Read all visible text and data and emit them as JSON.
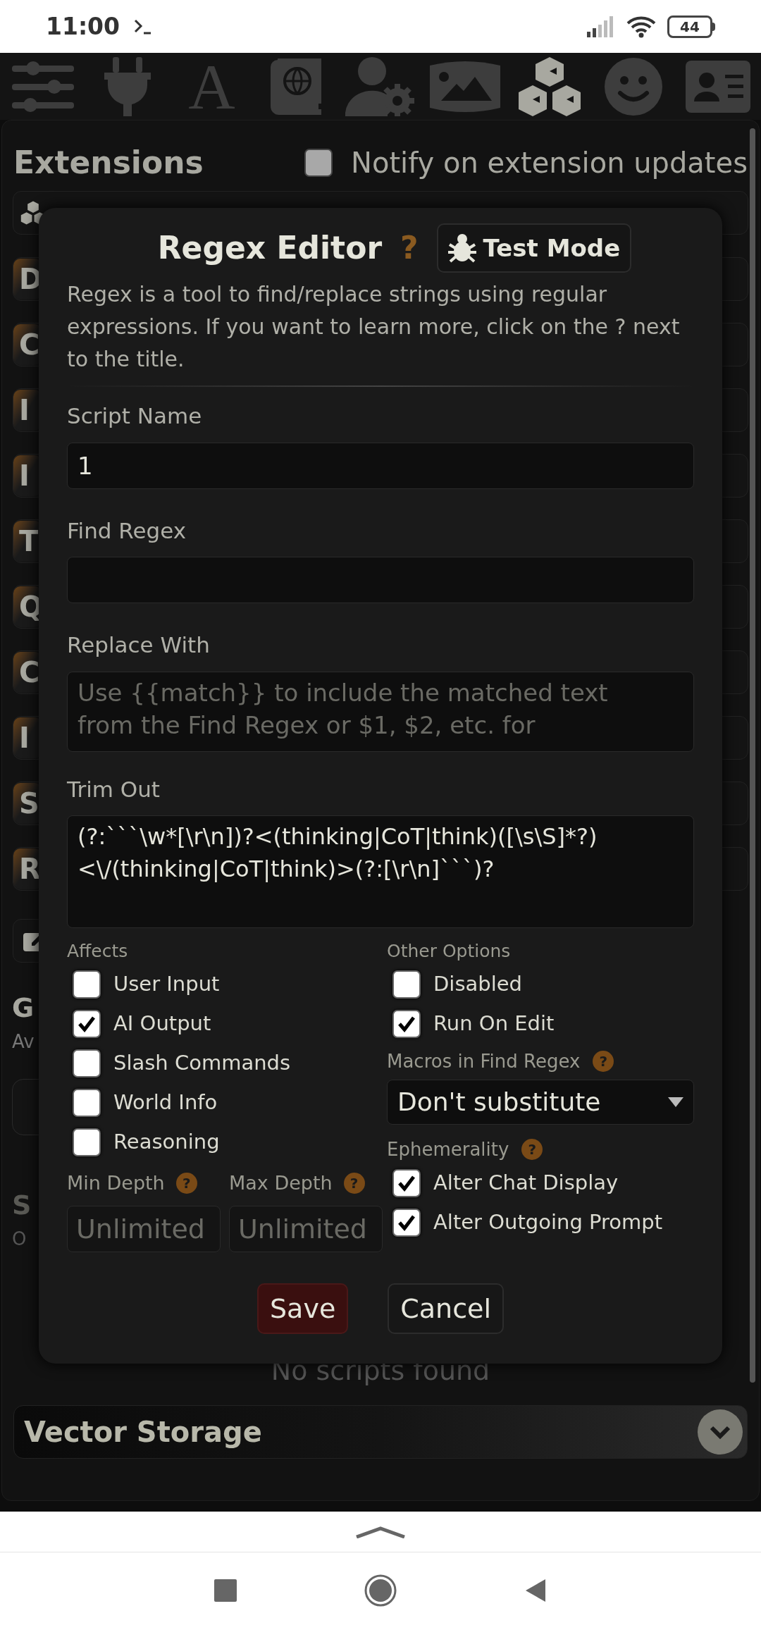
{
  "status_bar": {
    "time": "11:00",
    "battery": "44"
  },
  "toolbar": [
    {
      "kind": "sliders",
      "selected": false
    },
    {
      "kind": "plug",
      "selected": false
    },
    {
      "kind": "letter",
      "text": "A",
      "selected": false
    },
    {
      "kind": "book",
      "selected": false
    },
    {
      "kind": "user-gear",
      "selected": false
    },
    {
      "kind": "image",
      "selected": false
    },
    {
      "kind": "cubes",
      "selected": true
    },
    {
      "kind": "smiley",
      "selected": false
    },
    {
      "kind": "id-card",
      "selected": false
    }
  ],
  "extensions": {
    "title": "Extensions",
    "notify": {
      "label": "Notify on extension updates",
      "checked": false
    }
  },
  "extension_rows": [
    "D",
    "C",
    "I",
    "I",
    "T",
    "Q",
    "C",
    "I",
    "S",
    "R"
  ],
  "gallery": {
    "title": "G",
    "subtitle": "Av"
  },
  "scripts": {
    "title": "S",
    "subtitle": "O",
    "empty": "No scripts found"
  },
  "vector_storage": {
    "title": "Vector Storage"
  },
  "regex_editor": {
    "title": "Regex Editor",
    "help": "?",
    "test_mode": "Test Mode",
    "description": "Regex is a tool to find/replace strings using regular expressions. If you want to learn more, click on the ? next to the title.",
    "script_name": {
      "label": "Script Name",
      "value": "1"
    },
    "find_regex": {
      "label": "Find Regex"
    },
    "replace_with": {
      "label": "Replace With",
      "placeholder": "Use {{match}} to include the matched text from the Find Regex or $1, $2, etc. for"
    },
    "trim_out": {
      "label": "Trim Out",
      "value": "(?:```\\w*[\\r\\n])?<(thinking|CoT|think)([\\s\\S]*?)<\\/(thinking|CoT|think)>(?:[\\r\\n]```)?"
    },
    "affects": {
      "label": "Affects",
      "options": [
        {
          "label": "User Input",
          "checked": false
        },
        {
          "label": "AI Output",
          "checked": true
        },
        {
          "label": "Slash Commands",
          "checked": false
        },
        {
          "label": "World Info",
          "checked": false
        },
        {
          "label": "Reasoning",
          "checked": false
        }
      ]
    },
    "min_depth": {
      "label": "Min Depth",
      "help": "?",
      "placeholder": "Unlimited"
    },
    "max_depth": {
      "label": "Max Depth",
      "help": "?",
      "placeholder": "Unlimited"
    },
    "other_options": {
      "label": "Other Options",
      "options": [
        {
          "label": "Disabled",
          "checked": false
        },
        {
          "label": "Run On Edit",
          "checked": true
        }
      ]
    },
    "macros": {
      "label": "Macros in Find Regex",
      "help": "?",
      "value": "Don't substitute"
    },
    "ephemerality": {
      "label": "Ephemerality",
      "help": "?",
      "options": [
        {
          "label": "Alter Chat Display",
          "checked": true
        },
        {
          "label": "Alter Outgoing Prompt",
          "checked": true
        }
      ]
    },
    "buttons": [
      {
        "label": "Save",
        "kind": "primary"
      },
      {
        "label": "Cancel",
        "kind": "secondary"
      }
    ]
  }
}
